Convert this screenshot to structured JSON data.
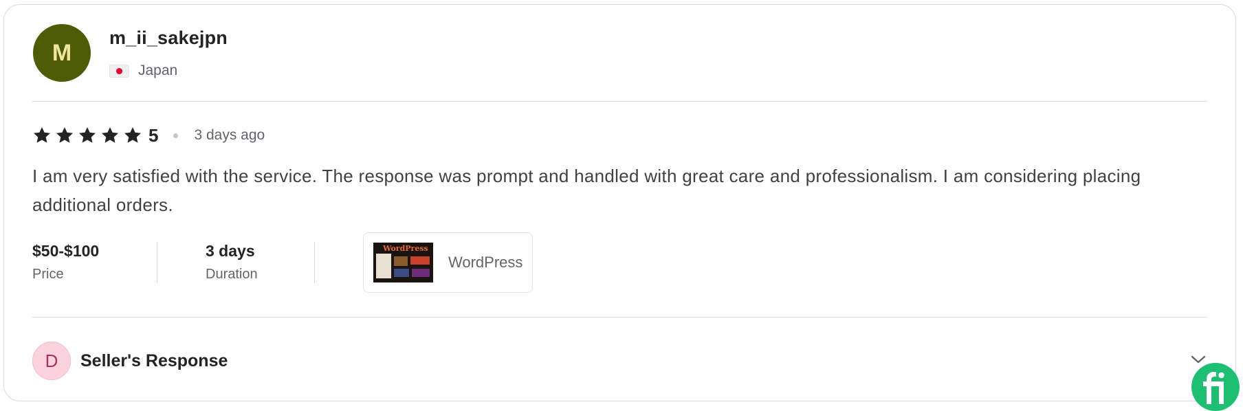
{
  "reviewer": {
    "avatar_initial": "M",
    "avatar_color": "#4d5c05",
    "username": "m_ii_sakejpn",
    "country": "Japan",
    "flag_icon": "japan-flag-icon"
  },
  "rating": {
    "stars": 5,
    "value": "5",
    "time_ago": "3 days ago"
  },
  "review": {
    "text": "I am very satisfied with the service. The response was prompt and handled with great care and professionalism. I am considering placing additional orders."
  },
  "meta": {
    "price_value": "$50-$100",
    "price_label": "Price",
    "duration_value": "3 days",
    "duration_label": "Duration",
    "gig_name": "WordPress"
  },
  "seller_response": {
    "avatar_initial": "D",
    "label": "Seller's Response",
    "expand_icon": "chevron-down-icon"
  },
  "brand": {
    "accent": "#1dbf73",
    "badge_icon": "fiverr-logo-icon"
  }
}
